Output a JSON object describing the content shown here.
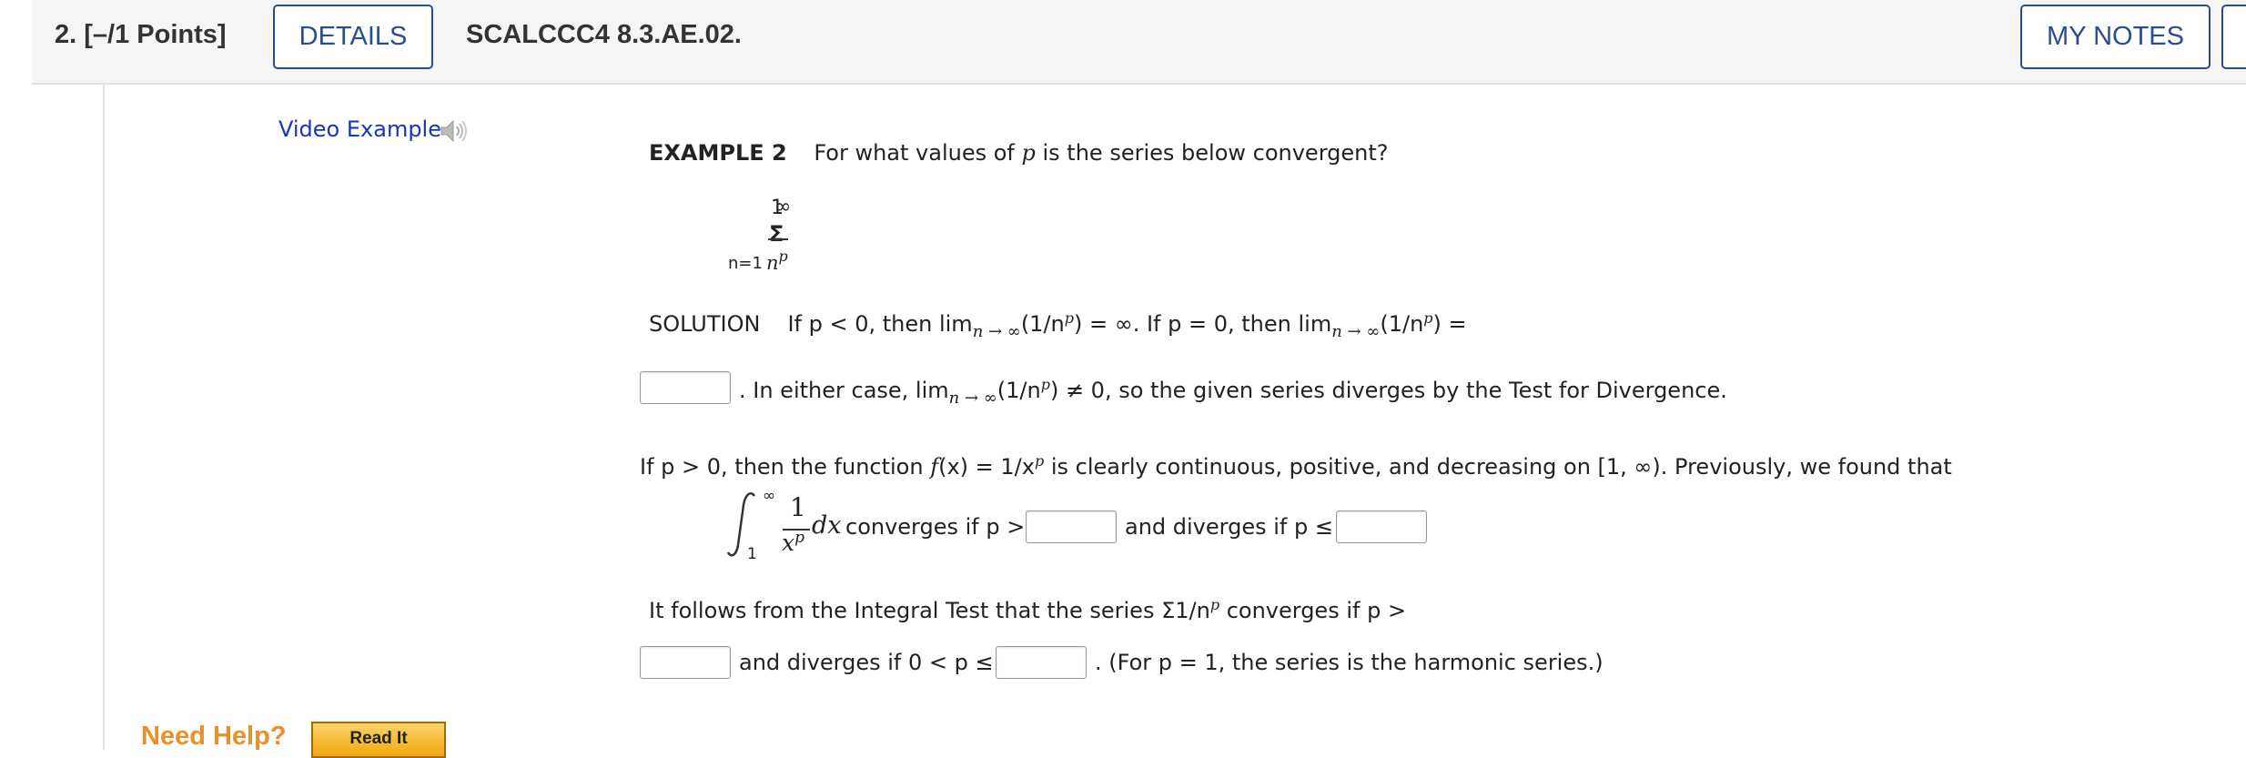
{
  "header": {
    "question_number": "2.",
    "points": "[–/1 Points]",
    "details_label": "DETAILS",
    "question_id": "SCALCCC4 8.3.AE.02.",
    "my_notes_label": "MY NOTES"
  },
  "video_example": {
    "label": "Video Example"
  },
  "example": {
    "label": "EXAMPLE 2",
    "prompt_pre": "For what values of ",
    "prompt_var": "p",
    "prompt_post": " is the series below convergent?"
  },
  "series": {
    "upper": "∞",
    "sigma": "Σ",
    "lower": "n=1",
    "numerator": "1",
    "denominator": "n",
    "denominator_exp": "p"
  },
  "solution": {
    "label": "SOLUTION",
    "line1": "If p < 0, then lim",
    "line1_sub": "n → ∞",
    "line1_b": "(1/n",
    "line1_sup": "p",
    "line1_c": ") = ∞. If p = 0, then lim",
    "line1_sub2": "n → ∞",
    "line1_d": "(1/n",
    "line1_sup2": "p",
    "line1_e": ") =",
    "line2_a": ". In either case, lim",
    "line2_sub": "n → ∞",
    "line2_b": "(1/n",
    "line2_sup": "p",
    "line2_c": ") ≠ 0, so the given series diverges by the Test for Divergence."
  },
  "paragraph2": {
    "text_a": "If p > 0, then the function ",
    "text_f": "f",
    "text_b": "(x) = 1/x",
    "text_sup": "p",
    "text_c": " is clearly continuous, positive, and decreasing on [1, ∞). Previously, we found that"
  },
  "integral": {
    "lower": "1",
    "upper": "∞",
    "numerator": "1",
    "denominator": "x",
    "denominator_exp": "p",
    "dx": "dx",
    "converges_text": "converges if p >",
    "diverges_text": "and diverges if p ≤"
  },
  "paragraph3": {
    "text": "It follows from the Integral Test that the series Σ1/n",
    "sup": "p",
    "text_b": " converges if p >"
  },
  "paragraph4": {
    "text_a": "and diverges if 0 < p ≤",
    "text_b": ". (For p = 1, the series is the harmonic series.)"
  },
  "help": {
    "need_help": "Need Help?",
    "read_it": "Read It"
  }
}
